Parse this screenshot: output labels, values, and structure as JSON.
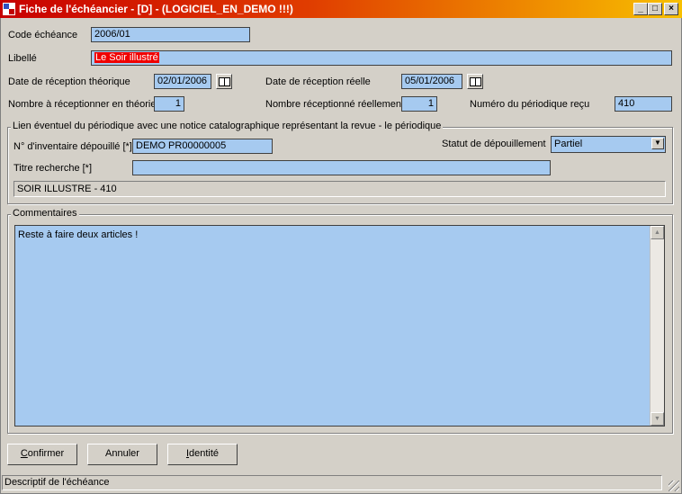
{
  "window": {
    "title": "Fiche de l'échéancier - [D] - (LOGICIEL_EN_DEMO !!!)",
    "controls": {
      "minimize": "_",
      "maximize": "□",
      "close": "×"
    }
  },
  "form": {
    "code_echeance": {
      "label": "Code échéance",
      "value": "2006/01"
    },
    "libelle": {
      "label": "Libellé",
      "value": "Le Soir illustré"
    },
    "date_reception_theorique": {
      "label": "Date de réception théorique",
      "value": "02/01/2006"
    },
    "date_reception_reelle": {
      "label": "Date de réception réelle",
      "value": "05/01/2006"
    },
    "nombre_theorie": {
      "label": "Nombre à réceptionner en théorie",
      "value": "1"
    },
    "nombre_reel": {
      "label": "Nombre réceptionné réellement",
      "value": "1"
    },
    "numero_periodique": {
      "label": "Numéro du périodique reçu",
      "value": "410"
    }
  },
  "lien": {
    "legend": "Lien éventuel du périodique avec une notice catalographique représentant la revue - le périodique",
    "inventaire": {
      "label": "N° d'inventaire dépouillé [*]",
      "value": "DEMO PR00000005"
    },
    "statut": {
      "label": "Statut de dépouillement",
      "value": "Partiel"
    },
    "titre": {
      "label": "Titre recherche [*]",
      "value": ""
    },
    "info": "SOIR ILLUSTRE - 410"
  },
  "commentaires": {
    "legend": "Commentaires",
    "text": "Reste à faire deux articles !"
  },
  "buttons": {
    "confirmer_first": "C",
    "confirmer_rest": "onfirmer",
    "annuler": "Annuler",
    "identite_first": "I",
    "identite_rest": "dentité"
  },
  "status": {
    "text": "Descriptif de l'échéance"
  },
  "colors": {
    "field_bg": "#a6caf0",
    "title_start": "#c80000",
    "title_end": "#f8c000",
    "highlight": "#f00000"
  }
}
